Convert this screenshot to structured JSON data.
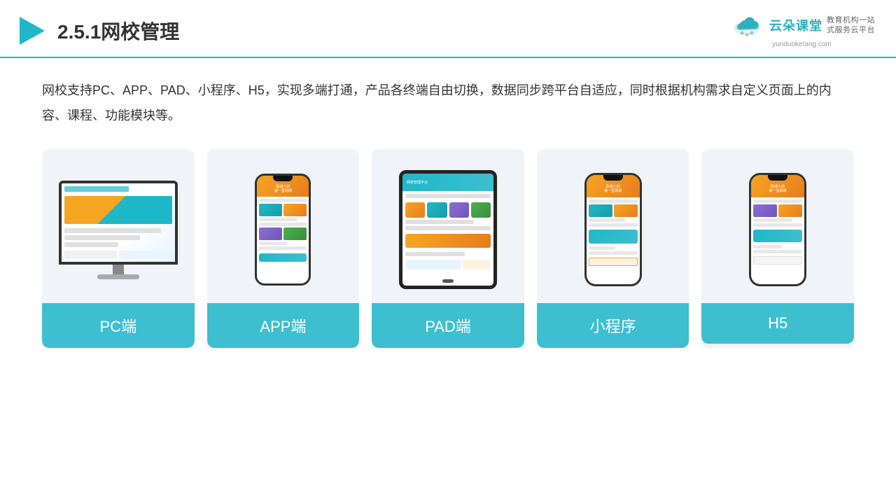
{
  "header": {
    "title": "2.5.1网校管理",
    "brand": {
      "name": "云朵课堂",
      "domain": "yunduoketang.com",
      "tagline": "教育机构一站",
      "tagline2": "式服务云平台"
    }
  },
  "main": {
    "description": "网校支持PC、APP、PAD、小程序、H5，实现多端打通，产品各终端自由切换，数据同步跨平台自适应，同时根据机构需求自定义页面上的内容、课程、功能模块等。",
    "cards": [
      {
        "id": "pc",
        "label": "PC端"
      },
      {
        "id": "app",
        "label": "APP端"
      },
      {
        "id": "pad",
        "label": "PAD端"
      },
      {
        "id": "miniprogram",
        "label": "小程序"
      },
      {
        "id": "h5",
        "label": "H5"
      }
    ]
  },
  "colors": {
    "accent": "#1fb8c8",
    "card_bg": "#f0f4f8",
    "card_label_bg": "#3dbfcf"
  }
}
